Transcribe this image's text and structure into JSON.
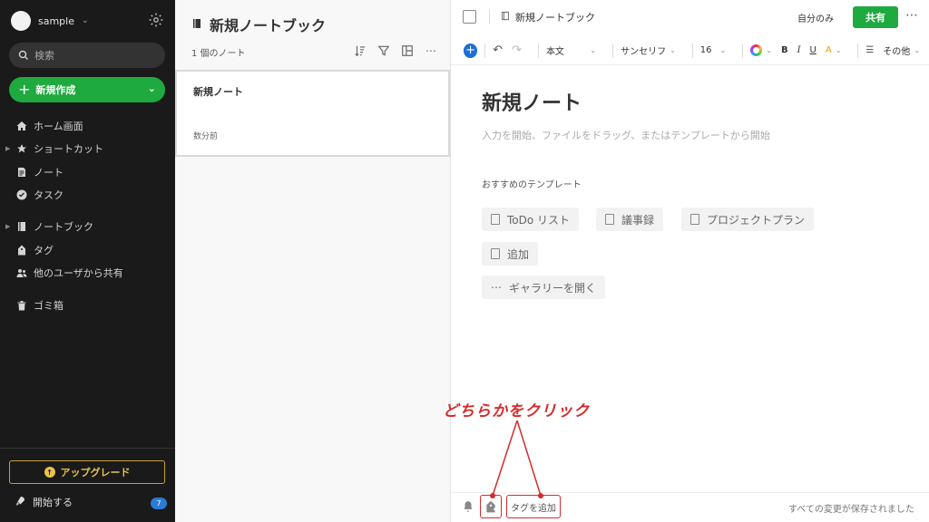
{
  "sidebar": {
    "account_name": "sample",
    "search_placeholder": "検索",
    "new_button": "新規作成",
    "nav": [
      {
        "label": "ホーム画面",
        "icon": "home-icon"
      },
      {
        "label": "ショートカット",
        "icon": "star-icon",
        "expandable": true
      },
      {
        "label": "ノート",
        "icon": "note-icon"
      },
      {
        "label": "タスク",
        "icon": "task-check-icon"
      },
      {
        "label": "ノートブック",
        "icon": "notebook-icon",
        "expandable": true
      },
      {
        "label": "タグ",
        "icon": "tag-icon"
      },
      {
        "label": "他のユーザから共有",
        "icon": "shared-users-icon"
      },
      {
        "label": "ゴミ箱",
        "icon": "trash-icon"
      }
    ],
    "upgrade_button": "アップグレード",
    "get_started": "開始する",
    "get_started_badge": "7"
  },
  "notelist": {
    "title": "新規ノートブック",
    "count": "1 個のノート",
    "notes": [
      {
        "title": "新規ノート",
        "date": "数分前"
      }
    ]
  },
  "editor": {
    "breadcrumb": "新規ノートブック",
    "visibility": "自分のみ",
    "share_button": "共有",
    "toolbar": {
      "style": "本文",
      "font": "サンセリフ",
      "size": "16",
      "more": "その他"
    },
    "note_title": "新規ノート",
    "placeholder": "入力を開始、ファイルをドラッグ、またはテンプレートから開始",
    "templates_label": "おすすめのテンプレート",
    "templates": [
      "ToDo リスト",
      "議事録",
      "プロジェクトプラン"
    ],
    "add_template": "追加",
    "open_gallery": "ギャラリーを開く",
    "tag_add": "タグを追加",
    "saved_status": "すべての変更が保存されました"
  },
  "annotation": {
    "text": "どちらかをクリック",
    "color": "#d62b2b"
  },
  "colors": {
    "sidebar_bg": "#1a1a1a",
    "accent_green": "#1faa3f",
    "upgrade_gold": "#e9c24b",
    "badge_blue": "#2a7bd6"
  }
}
